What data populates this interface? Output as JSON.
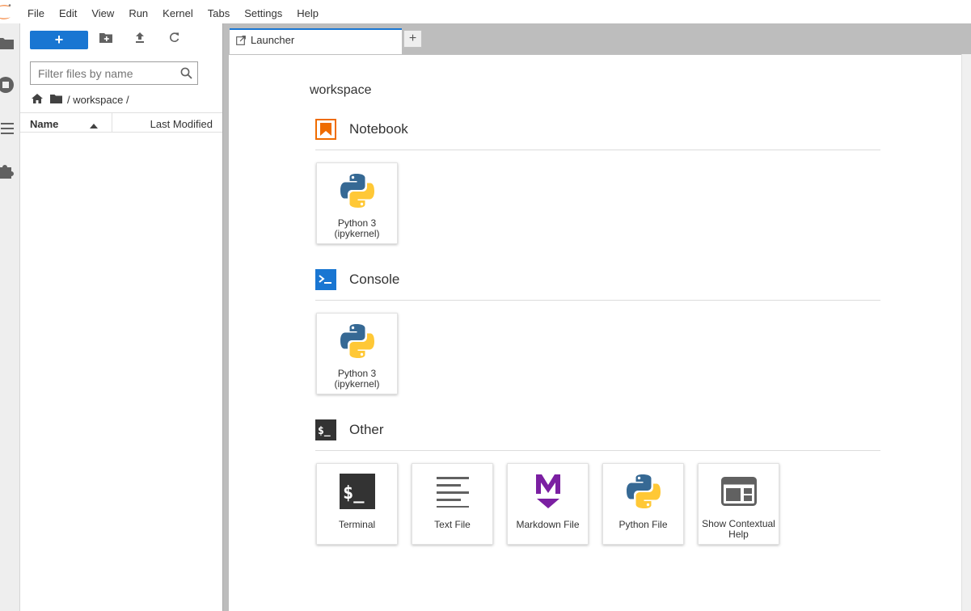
{
  "menubar": {
    "items": [
      "File",
      "Edit",
      "View",
      "Run",
      "Kernel",
      "Tabs",
      "Settings",
      "Help"
    ]
  },
  "leftbar": {
    "tabs": [
      "folder-icon",
      "running-icon",
      "toc-icon",
      "extension-icon"
    ]
  },
  "filebrowser": {
    "new_button_label": "+",
    "filter_placeholder": "Filter files by name",
    "breadcrumb_path": "/ workspace /",
    "column_name": "Name",
    "column_modified": "Last Modified"
  },
  "tabs": [
    {
      "label": "Launcher",
      "active": true
    }
  ],
  "add_tab_label": "+",
  "launcher": {
    "cwd": "workspace",
    "sections": {
      "notebook": {
        "title": "Notebook",
        "color": "#ef6c00",
        "cards": [
          {
            "label": "Python 3 (ipykernel)"
          }
        ]
      },
      "console": {
        "title": "Console",
        "color": "#1976d2",
        "cards": [
          {
            "label": "Python 3 (ipykernel)"
          }
        ]
      },
      "other": {
        "title": "Other",
        "color": "#333333",
        "cards": [
          {
            "label": "Terminal"
          },
          {
            "label": "Text File"
          },
          {
            "label": "Markdown File"
          },
          {
            "label": "Python File"
          },
          {
            "label": "Show Contextual Help"
          }
        ]
      }
    }
  },
  "colors": {
    "accent": "#1976d2",
    "markdown": "#7b1fa2",
    "python_blue": "#366994",
    "python_yellow": "#ffc836"
  }
}
